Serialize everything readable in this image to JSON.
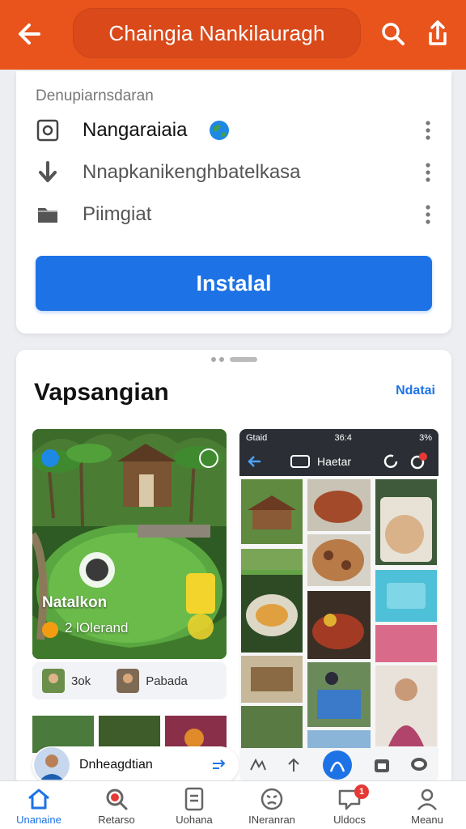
{
  "header": {
    "title": "Chaingia Nankilauragh",
    "back_icon": "back-arrow-icon",
    "search_icon": "search-icon",
    "share_icon": "share-icon",
    "bg_color": "#e8541b"
  },
  "info_card": {
    "section_label": "Denupiarnsdaran",
    "rows": [
      {
        "icon": "camera-icon",
        "label": "Nangaraiaia"
      },
      {
        "icon": "download-icon",
        "label": "Nnapkanikenghbatelkasa"
      },
      {
        "icon": "folder-icon",
        "label": "Piimgiat"
      }
    ],
    "install_label": "Instalal",
    "accent_color": "#1d73e6"
  },
  "preview_card": {
    "title": "Vapsangian",
    "more_label": "Ndatai",
    "photo_left": {
      "caption": "Natalkon",
      "sub_label": "2 lOlerand"
    },
    "chips": [
      {
        "label": "3ok"
      },
      {
        "label": "Pabada"
      }
    ],
    "profile": {
      "name": "Dnheagdtian"
    },
    "phone": {
      "status_left": "Gtaid",
      "status_time": "36:4",
      "status_right": "3%",
      "appbar_title": "Haetar"
    }
  },
  "bottom_nav": [
    {
      "icon": "home-icon",
      "label": "Unanaine",
      "active": true
    },
    {
      "icon": "search-icon",
      "label": "Retarso",
      "active": false
    },
    {
      "icon": "document-icon",
      "label": "Uohana",
      "active": false
    },
    {
      "icon": "face-icon",
      "label": "INeranran",
      "active": false
    },
    {
      "icon": "message-icon",
      "label": "Uldocs",
      "active": false,
      "badge": "1"
    },
    {
      "icon": "person-icon",
      "label": "Meanu",
      "active": false
    }
  ]
}
